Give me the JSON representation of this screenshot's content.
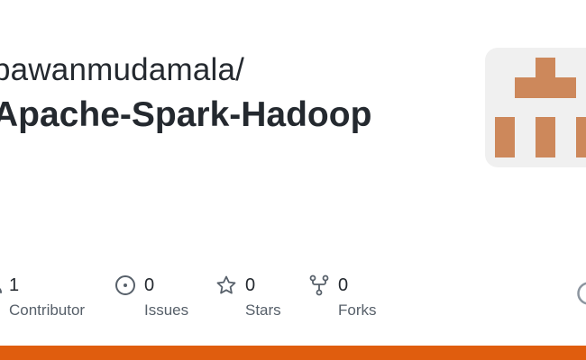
{
  "repo_card": {
    "owner": "pawanmudamala/",
    "name": "Apache-Spark-Hadoop",
    "stats": [
      {
        "count": "1",
        "label": "Contributor",
        "icon": "contributor-icon"
      },
      {
        "count": "0",
        "label": "Issues",
        "icon": "issue-opened-icon"
      },
      {
        "count": "0",
        "label": "Stars",
        "icon": "star-icon"
      },
      {
        "count": "0",
        "label": "Forks",
        "icon": "repo-forked-icon"
      }
    ],
    "avatar_icon": "identicon-avatar",
    "language_bar_icon": "language-color-bar"
  },
  "colors": {
    "text_primary": "#24292f",
    "text_secondary": "#57606a",
    "avatar_bg": "#f0f0f0",
    "avatar_fg": "#cd885b",
    "language_bar": "#e05d0e",
    "icon": "#57606a"
  }
}
